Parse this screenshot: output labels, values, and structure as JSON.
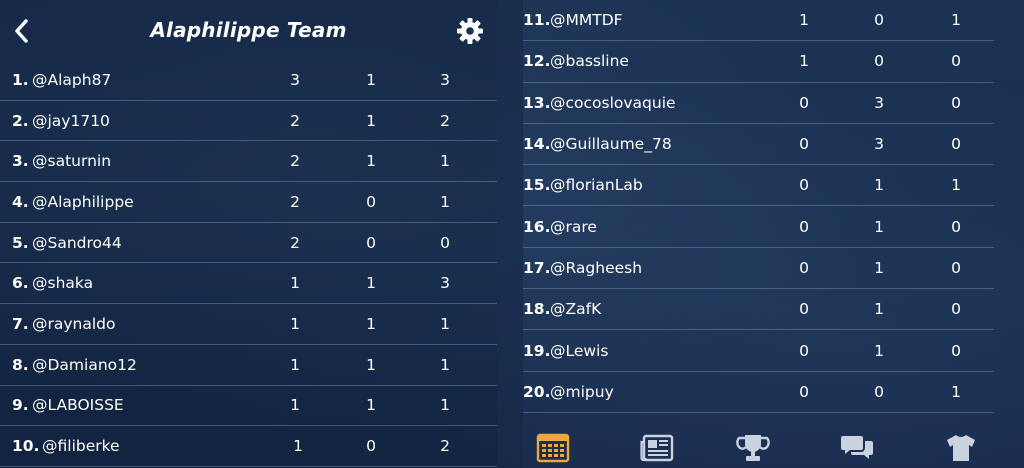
{
  "header": {
    "title": "Alaphilippe Team"
  },
  "colors": {
    "accent": "#f0a73a",
    "icon_inactive": "#c9d2de",
    "text": "#ffffff"
  },
  "rows_left": [
    {
      "rank": "1.",
      "user": "@Alaph87",
      "a": "3",
      "b": "1",
      "c": "3"
    },
    {
      "rank": "2.",
      "user": "@jay1710",
      "a": "2",
      "b": "1",
      "c": "2"
    },
    {
      "rank": "3.",
      "user": "@saturnin",
      "a": "2",
      "b": "1",
      "c": "1"
    },
    {
      "rank": "4.",
      "user": "@Alaphilippe",
      "a": "2",
      "b": "0",
      "c": "1"
    },
    {
      "rank": "5.",
      "user": "@Sandro44",
      "a": "2",
      "b": "0",
      "c": "0"
    },
    {
      "rank": "6.",
      "user": "@shaka",
      "a": "1",
      "b": "1",
      "c": "3"
    },
    {
      "rank": "7.",
      "user": "@raynaldo",
      "a": "1",
      "b": "1",
      "c": "1"
    },
    {
      "rank": "8.",
      "user": "@Damiano12",
      "a": "1",
      "b": "1",
      "c": "1"
    },
    {
      "rank": "9.",
      "user": "@LABOISSE",
      "a": "1",
      "b": "1",
      "c": "1"
    },
    {
      "rank": "10.",
      "user": "@filiberke",
      "a": "1",
      "b": "0",
      "c": "2"
    }
  ],
  "rows_right": [
    {
      "rank": "11.",
      "user": "@MMTDF",
      "a": "1",
      "b": "0",
      "c": "1"
    },
    {
      "rank": "12.",
      "user": "@bassline",
      "a": "1",
      "b": "0",
      "c": "0"
    },
    {
      "rank": "13.",
      "user": "@cocoslovaquie",
      "a": "0",
      "b": "3",
      "c": "0"
    },
    {
      "rank": "14.",
      "user": "@Guillaume_78",
      "a": "0",
      "b": "3",
      "c": "0"
    },
    {
      "rank": "15.",
      "user": "@florianLab",
      "a": "0",
      "b": "1",
      "c": "1"
    },
    {
      "rank": "16.",
      "user": "@rare",
      "a": "0",
      "b": "1",
      "c": "0"
    },
    {
      "rank": "17.",
      "user": "@Ragheesh",
      "a": "0",
      "b": "1",
      "c": "0"
    },
    {
      "rank": "18.",
      "user": "@ZafK",
      "a": "0",
      "b": "1",
      "c": "0"
    },
    {
      "rank": "19.",
      "user": "@Lewis",
      "a": "0",
      "b": "1",
      "c": "0"
    },
    {
      "rank": "20.",
      "user": "@mipuy",
      "a": "0",
      "b": "0",
      "c": "1"
    }
  ],
  "tabbar": {
    "tabs": [
      {
        "icon": "calendar-icon",
        "active": true
      },
      {
        "icon": "newspaper-icon",
        "active": false
      },
      {
        "icon": "trophy-icon",
        "active": false
      },
      {
        "icon": "chat-icon",
        "active": false
      },
      {
        "icon": "jersey-icon",
        "active": false
      }
    ]
  }
}
